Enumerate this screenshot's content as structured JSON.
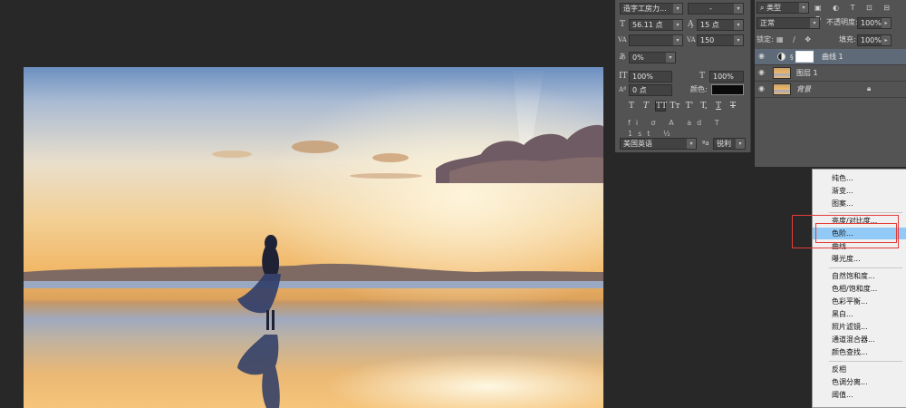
{
  "character_panel": {
    "font_family": "造字工房力...",
    "font_style": "-",
    "font_size": "56.11 点",
    "leading": "15 点",
    "kerning": "",
    "tracking": "150",
    "vertical_shift": "0%",
    "vertical_scale": "100%",
    "horizontal_scale": "100%",
    "baseline_shift": "0 点",
    "color_label": "颜色:",
    "color_value": "#0a0a0a",
    "style_buttons": [
      "T",
      "T",
      "TT",
      "Tт",
      "T'",
      "T,",
      "T",
      "T"
    ],
    "language": "美国英语",
    "antialias": "锐利"
  },
  "layers_panel": {
    "filter_kind": "类型",
    "blend_mode": "正常",
    "opacity_label": "不透明度:",
    "opacity_value": "100%",
    "lock_label": "锁定:",
    "fill_label": "填充:",
    "fill_value": "100%",
    "layers": [
      {
        "name": "曲线 1",
        "type": "adjustment",
        "selected": true
      },
      {
        "name": "图层 1",
        "type": "image",
        "selected": false
      },
      {
        "name": "背景",
        "type": "image",
        "selected": false,
        "locked": true
      }
    ]
  },
  "adjustment_menu": {
    "items": [
      "纯色...",
      "渐变...",
      "图案...",
      "亮度/对比度...",
      "色阶...",
      "曲线...",
      "曝光度...",
      "自然饱和度...",
      "色相/饱和度...",
      "色彩平衡...",
      "黑白...",
      "照片滤镜...",
      "通道混合器...",
      "颜色查找...",
      "反相",
      "色调分离...",
      "阈值..."
    ],
    "highlighted": "色阶..."
  },
  "colors": {
    "app_background": "#282828",
    "panel": "#535353",
    "menu_highlight": "#91c9f7",
    "annotation_red": "#e33c3c"
  }
}
